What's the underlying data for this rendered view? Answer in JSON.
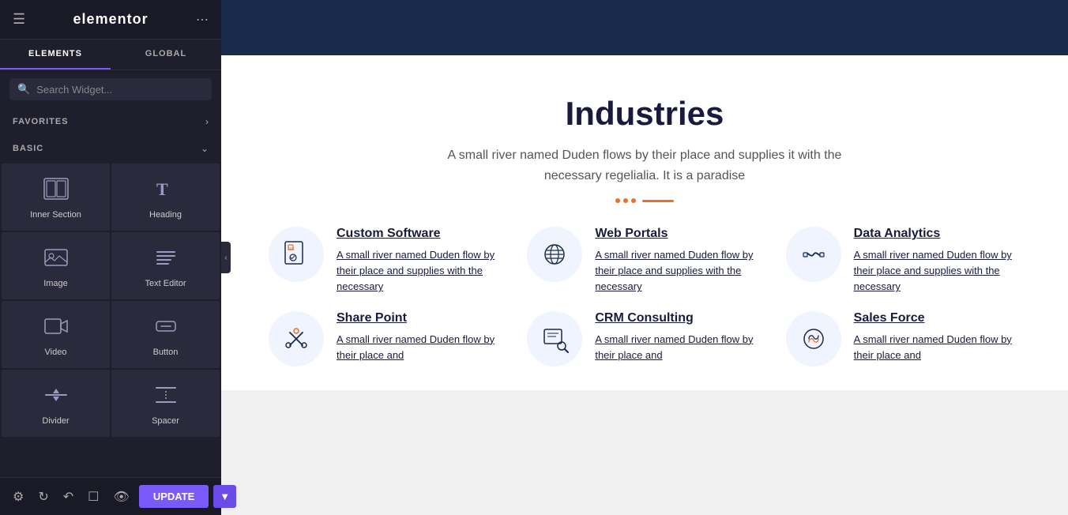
{
  "sidebar": {
    "logo": "elementor",
    "tabs": [
      {
        "id": "elements",
        "label": "ELEMENTS",
        "active": true
      },
      {
        "id": "global",
        "label": "GLOBAL",
        "active": false
      }
    ],
    "search_placeholder": "Search Widget...",
    "favorites_label": "FAVORITES",
    "basic_label": "BASIC",
    "widgets": [
      {
        "id": "inner-section",
        "label": "Inner Section",
        "icon": "inner-section"
      },
      {
        "id": "heading",
        "label": "Heading",
        "icon": "heading"
      },
      {
        "id": "image",
        "label": "Image",
        "icon": "image"
      },
      {
        "id": "text-editor",
        "label": "Text Editor",
        "icon": "text-editor"
      },
      {
        "id": "video",
        "label": "Video",
        "icon": "video"
      },
      {
        "id": "button",
        "label": "Button",
        "icon": "button"
      },
      {
        "id": "divider",
        "label": "Divider",
        "icon": "divider"
      },
      {
        "id": "spacer",
        "label": "Spacer",
        "icon": "spacer"
      }
    ],
    "update_label": "UPDATE"
  },
  "main": {
    "industries": {
      "title": "Industries",
      "subtitle": "A small river named Duden flows by their place and supplies it with the necessary regelialia. It is a paradise",
      "cards": [
        {
          "title": "Custom Software",
          "desc": "A small river named Duden flow by their place and supplies with the necessary",
          "icon": "💻"
        },
        {
          "title": "Web Portals",
          "desc": "A small river named Duden flow by their place and supplies with the necessary",
          "icon": "⏰"
        },
        {
          "title": "Data Analytics",
          "desc": "A small river named Duden flow by their place and supplies with the necessary",
          "icon": "🤝"
        },
        {
          "title": "Share Point",
          "desc": "A small river named Duden flow by their place and",
          "icon": "✂️"
        },
        {
          "title": "CRM Consulting",
          "desc": "A small river named Duden flow by their place and",
          "icon": "🔍"
        },
        {
          "title": "Sales Force",
          "desc": "A small river named Duden flow by their place and",
          "icon": "⚙️"
        }
      ]
    }
  },
  "colors": {
    "accent": "#7a5af8",
    "orange": "#e8702a",
    "dark_navy": "#1a1a3e"
  }
}
